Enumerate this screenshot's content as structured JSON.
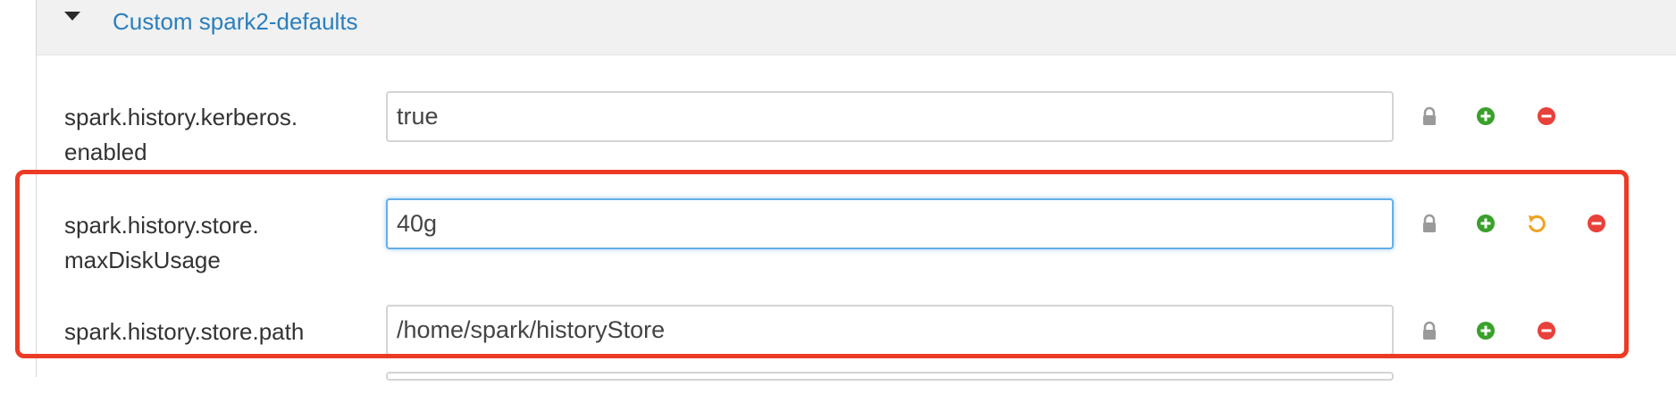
{
  "section": {
    "title": "Custom spark2-defaults",
    "collapse_icon": "caret-down-icon"
  },
  "properties": [
    {
      "name_line1": "spark.history.kerberos.",
      "name_line2": "enabled",
      "value": "true",
      "actions": [
        "lock-icon",
        "plus-circle-icon",
        "minus-circle-icon"
      ]
    },
    {
      "name_line1": "spark.history.store.",
      "name_line2": "maxDiskUsage",
      "value": "40g",
      "actions": [
        "lock-icon",
        "plus-circle-icon",
        "undo-icon",
        "minus-circle-icon"
      ]
    },
    {
      "name_line1": "spark.history.store.path",
      "name_line2": "",
      "value": "/home/spark/historyStore",
      "actions": [
        "lock-icon",
        "plus-circle-icon",
        "minus-circle-icon"
      ]
    }
  ],
  "colors": {
    "title_link": "#2a7fbd",
    "add_green": "#3aa02b",
    "remove_red": "#e8403a",
    "undo_orange": "#f0a21f",
    "lock_gray": "#9a9a9a",
    "highlight_red": "#ec3b24",
    "focus_blue": "#66afe9"
  }
}
